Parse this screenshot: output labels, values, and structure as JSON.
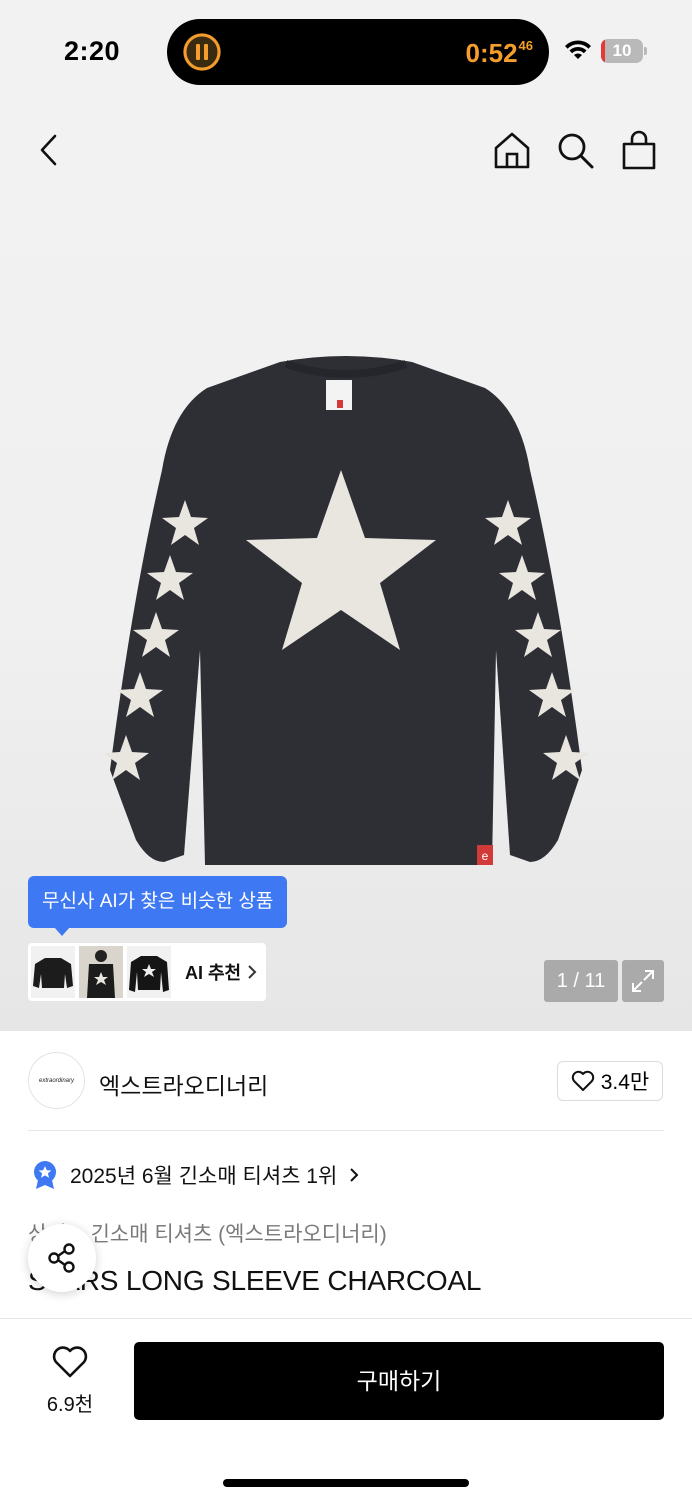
{
  "status": {
    "time": "2:20",
    "timer": "0:52",
    "timer_fraction": "46",
    "battery_level": "10",
    "battery_fraction": 0.1,
    "timer_color": "#f59e2c"
  },
  "nav": {
    "back_icon": "chevron-left-icon",
    "home_icon": "home-icon",
    "search_icon": "search-icon",
    "bag_icon": "shopping-bag-icon"
  },
  "gallery": {
    "ai_tooltip": "무신사 AI가 찾은 비슷한 상품",
    "ai_recommend_label": "AI 추천",
    "counter": "1 / 11",
    "accent": "#3e78f3"
  },
  "brand": {
    "logo_text": "extraordinary",
    "name": "엑스트라오디너리",
    "likes": "3.4만"
  },
  "product": {
    "ranking": "2025년 6월 긴소매 티셔츠 1위",
    "category": "상의 > 긴소매 티셔츠 (엑스트라오디너리)",
    "name": "STARS LONG SLEEVE CHARCOAL"
  },
  "bottom": {
    "wish_count": "6.9천",
    "buy_label": "구매하기"
  }
}
